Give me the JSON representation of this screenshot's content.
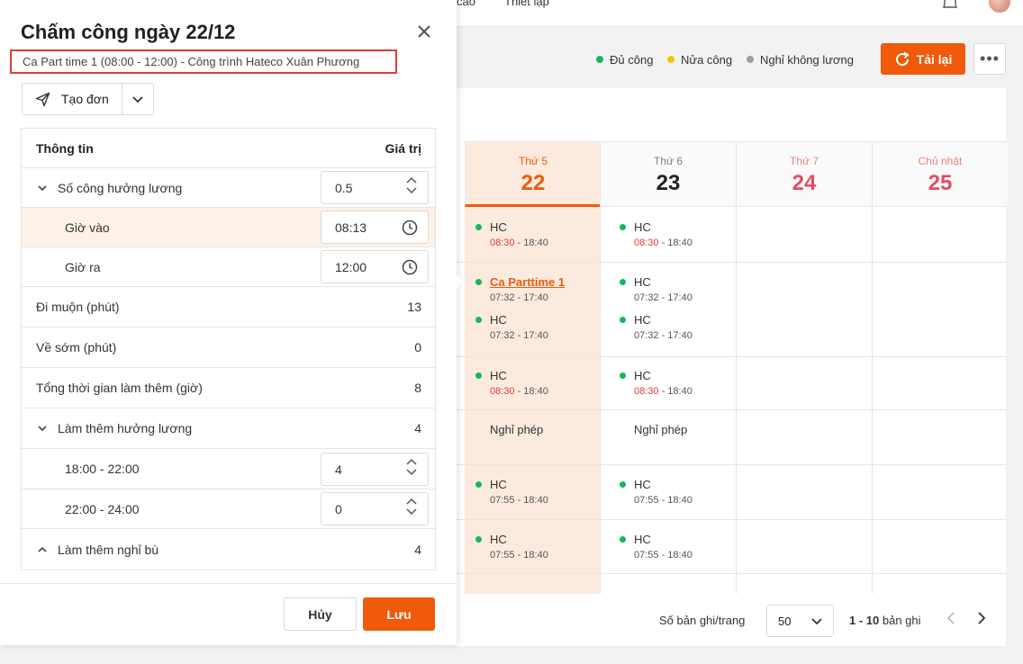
{
  "topnav": {
    "item1": "cáo",
    "item2": "Thiết lập"
  },
  "legend": [
    {
      "label": "Đủ công",
      "color": "#12b85a"
    },
    {
      "label": "Nửa công",
      "color": "#f5c400"
    },
    {
      "label": "Nghỉ không lương",
      "color": "#9e9e9e"
    }
  ],
  "toolbar": {
    "reload_label": "Tải lại",
    "more_label": "•••"
  },
  "calendar": {
    "days": [
      {
        "name": "Thứ 5",
        "num": "22"
      },
      {
        "name": "Thứ 6",
        "num": "23"
      },
      {
        "name": "Thứ 7",
        "num": "24"
      },
      {
        "name": "Chủ nhật",
        "num": "25"
      }
    ],
    "thu": {
      "r1": {
        "name": "HC",
        "late": "08:30",
        "rest": " - 18:40"
      },
      "r2a": {
        "name": "Ca Parttime 1",
        "time": "07:32 - 17:40"
      },
      "r2b": {
        "name": "HC",
        "time": "07:32 - 17:40"
      },
      "r3": {
        "name": "HC",
        "late": "08:30",
        "rest": " - 18:40"
      },
      "r4": {
        "name": "Nghỉ phép"
      },
      "r5": {
        "name": "HC",
        "time": "07:55 - 18:40"
      },
      "r6": {
        "name": "HC",
        "time": "07:55 - 18:40"
      }
    },
    "fri": {
      "r1": {
        "name": "HC",
        "late": "08:30",
        "rest": " - 18:40"
      },
      "r2a": {
        "name": "HC",
        "time": "07:32 - 17:40"
      },
      "r2b": {
        "name": "HC",
        "time": "07:32 - 17:40"
      },
      "r3": {
        "name": "HC",
        "late": "08:30",
        "rest": " - 18:40"
      },
      "r4": {
        "name": "Nghỉ phép"
      },
      "r5": {
        "name": "HC",
        "time": "07:55 - 18:40"
      },
      "r6": {
        "name": "HC",
        "time": "07:55 - 18:40"
      }
    }
  },
  "pager": {
    "per_page_label": "Số bản ghi/trang",
    "per_page_value": "50",
    "range": "1 - 10",
    "range_suffix": " bản ghi"
  },
  "dialog": {
    "title": "Chấm công ngày 22/12",
    "subtitle": "Ca Part time 1 (08:00 - 12:00) - Công trình Hateco Xuân Phương",
    "create_label": "Tạo đơn",
    "table": {
      "col_info": "Thông tin",
      "col_value": "Giá trị",
      "so_cong_label": "Số công hưởng lương",
      "so_cong_value": "0.5",
      "gio_vao_label": "Giờ vào",
      "gio_vao_value": "08:13",
      "gio_ra_label": "Giờ ra",
      "gio_ra_value": "12:00",
      "di_muon_label": "Đi muộn (phút)",
      "di_muon_value": "13",
      "ve_som_label": "Về sớm (phút)",
      "ve_som_value": "0",
      "tong_lam_them_label": "Tổng thời gian làm thêm (giờ)",
      "tong_lam_them_value": "8",
      "lam_them_luong_label": "Làm thêm hưởng lương",
      "lam_them_luong_value": "4",
      "slot1_label": "18:00 - 22:00",
      "slot1_value": "4",
      "slot2_label": "22:00 - 24:00",
      "slot2_value": "0",
      "lam_them_nghi_bu_label": "Làm thêm nghỉ bù",
      "lam_them_nghi_bu_value": "4"
    },
    "cancel_label": "Hủy",
    "save_label": "Lưu"
  }
}
